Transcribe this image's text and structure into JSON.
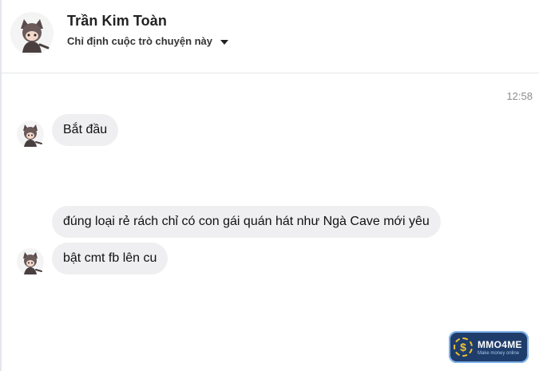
{
  "header": {
    "contact_name": "Trần Kim Toàn",
    "subtitle": "Chỉ định cuộc trò chuyện này",
    "dropdown_icon": "caret-down-icon",
    "avatar_icon": "cat-avatar-icon"
  },
  "conversation": {
    "timestamp": "12:58",
    "messages": [
      {
        "text": "Bắt đầu"
      },
      {
        "text": "đúng loại rẻ rách chỉ có con gái quán hát như Ngà Cave mới yêu"
      },
      {
        "text": "bật cmt fb lên cu"
      }
    ]
  },
  "watermark": {
    "brand": "MMO4ME",
    "tagline": "Make money online",
    "symbol": "$"
  },
  "colors": {
    "bubble": "#efeff1",
    "divider": "#e4e6eb",
    "timestamp": "#8a8d91",
    "watermark_bg": "#1f3d6b"
  }
}
